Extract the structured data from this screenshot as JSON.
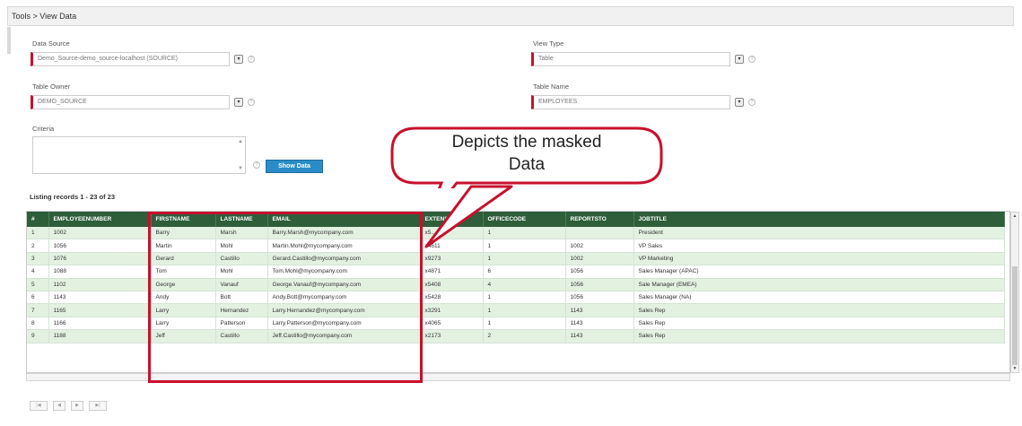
{
  "breadcrumb": "Tools > View Data",
  "form": {
    "data_source": {
      "label": "Data Source",
      "value": "Demo_Source-demo_source-localhost (SOURCE)"
    },
    "view_type": {
      "label": "View Type",
      "value": "Table"
    },
    "table_owner": {
      "label": "Table Owner",
      "value": "DEMO_SOURCE"
    },
    "table_name": {
      "label": "Table Name",
      "value": "EMPLOYEES"
    },
    "criteria": {
      "label": "Criteria",
      "value": ""
    },
    "show_data_label": "Show Data"
  },
  "listing": "Listing records 1 - 23 of 23",
  "grid": {
    "columns": [
      "#",
      "EMPLOYEENUMBER",
      "FIRSTNAME",
      "LASTNAME",
      "EMAIL",
      "EXTENSION",
      "OFFICECODE",
      "REPORTSTO",
      "JOBTITLE"
    ],
    "rows": [
      [
        "1",
        "1002",
        "Barry",
        "Marsh",
        "Barry.Marsh@mycompany.com",
        "x5...",
        "1",
        "",
        "President"
      ],
      [
        "2",
        "1056",
        "Martin",
        "Mohl",
        "Martin.Mohl@mycompany.com",
        "x4611",
        "1",
        "1002",
        "VP Sales"
      ],
      [
        "3",
        "1076",
        "Gerard",
        "Castillo",
        "Gerard.Castillo@mycompany.com",
        "x9273",
        "1",
        "1002",
        "VP Marketing"
      ],
      [
        "4",
        "1088",
        "Tom",
        "Mohl",
        "Tom.Mohl@mycompany.com",
        "x4871",
        "6",
        "1056",
        "Sales Manager (APAC)"
      ],
      [
        "5",
        "1102",
        "George",
        "Vanauf",
        "George.Vanauf@mycompany.com",
        "x5408",
        "4",
        "1056",
        "Sale Manager (EMEA)"
      ],
      [
        "6",
        "1143",
        "Andy",
        "Bott",
        "Andy.Bott@mycompany.com",
        "x5428",
        "1",
        "1056",
        "Sales Manager (NA)"
      ],
      [
        "7",
        "1165",
        "Larry",
        "Hernandez",
        "Larry.Hernandez@mycompany.com",
        "x3291",
        "1",
        "1143",
        "Sales Rep"
      ],
      [
        "8",
        "1166",
        "Larry",
        "Patterson",
        "Larry.Patterson@mycompany.com",
        "x4065",
        "1",
        "1143",
        "Sales Rep"
      ],
      [
        "9",
        "1188",
        "Jeff",
        "Castillo",
        "Jeff.Castillo@mycompany.com",
        "x2173",
        "2",
        "1143",
        "Sales Rep"
      ]
    ]
  },
  "callout": {
    "line1": "Depicts the masked",
    "line2": "Data"
  },
  "colors": {
    "header_green": "#2e5e3a",
    "row_alt": "#e3f1e1",
    "accent_red": "#c8102e",
    "button_blue": "#2a8cc7"
  }
}
